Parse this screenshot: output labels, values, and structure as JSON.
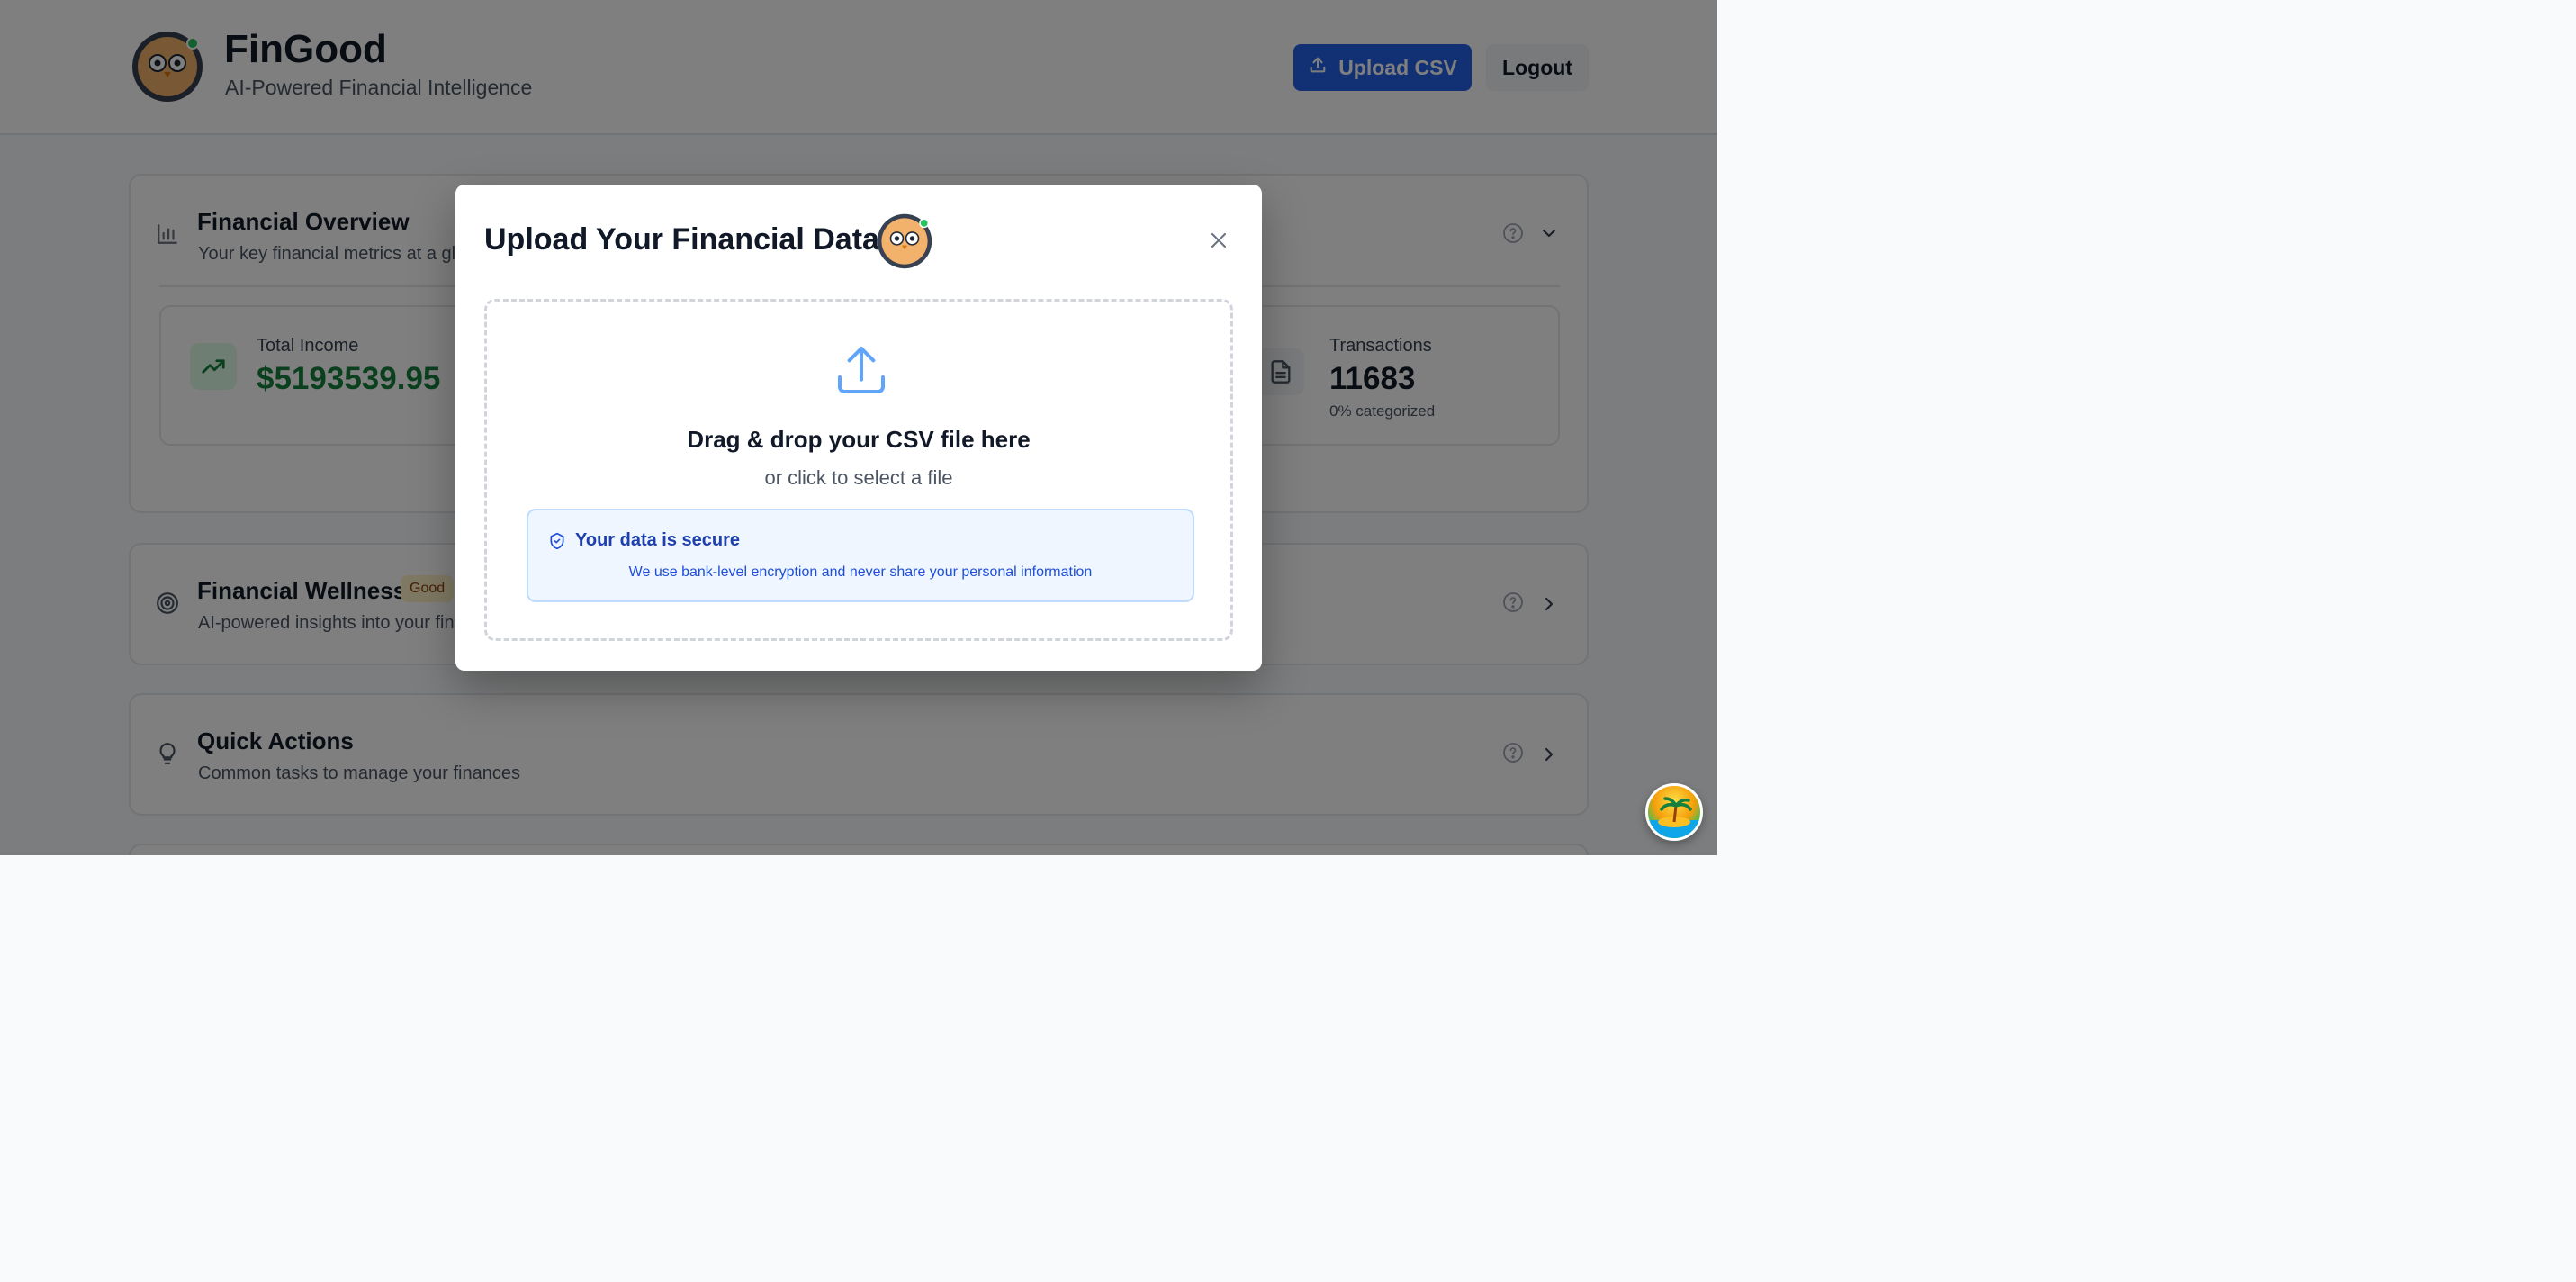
{
  "header": {
    "brand_title": "FinGood",
    "brand_subtitle": "AI-Powered Financial Intelligence",
    "upload_button": "Upload CSV",
    "logout_button": "Logout"
  },
  "overview": {
    "title": "Financial Overview",
    "subtitle": "Your key financial metrics at a glance",
    "metrics": [
      {
        "label": "Total Income",
        "value": "$5193539.95",
        "color": "#15803d",
        "icon": "trending-up-icon"
      },
      {
        "label": "Transactions",
        "value": "11683",
        "note": "0% categorized",
        "color": "#111827",
        "icon": "document-icon"
      }
    ]
  },
  "wellness": {
    "title": "Financial Wellness",
    "badge": "Good",
    "subtitle": "AI-powered insights into your financial health"
  },
  "quick_actions": {
    "title": "Quick Actions",
    "subtitle": "Common tasks to manage your finances"
  },
  "modal": {
    "title": "Upload Your Financial Data",
    "dropzone_title": "Drag & drop your CSV file here",
    "dropzone_subtitle": "or click to select a file",
    "secure_title": "Your data is secure",
    "secure_text": "We use bank-level encryption and never share your personal information"
  },
  "colors": {
    "primary": "#2563eb",
    "income": "#15803d",
    "secure_bg": "#eff6ff",
    "secure_text": "#1d4ed8"
  }
}
